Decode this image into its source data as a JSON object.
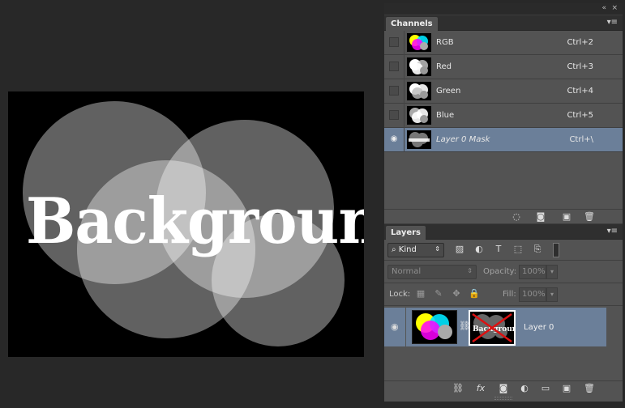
{
  "canvas": {
    "text": "Background"
  },
  "dock": {
    "collapse_icon": "double-chevron-icon",
    "close_icon": "close-icon"
  },
  "channels": {
    "tab_label": "Channels",
    "menu_icon": "panel-menu-icon",
    "rows": [
      {
        "name": "RGB",
        "shortcut": "Ctrl+2",
        "visible": false,
        "selected": false
      },
      {
        "name": "Red",
        "shortcut": "Ctrl+3",
        "visible": false,
        "selected": false
      },
      {
        "name": "Green",
        "shortcut": "Ctrl+4",
        "visible": false,
        "selected": false
      },
      {
        "name": "Blue",
        "shortcut": "Ctrl+5",
        "visible": false,
        "selected": false
      },
      {
        "name": "Layer 0 Mask",
        "shortcut": "Ctrl+\\",
        "visible": true,
        "selected": true
      }
    ],
    "footer_icons": [
      "load-selection-icon",
      "save-selection-icon",
      "new-channel-icon",
      "trash-icon"
    ]
  },
  "layers": {
    "tab_label": "Layers",
    "menu_icon": "panel-menu-icon",
    "kind_label": "Kind",
    "blend_mode": "Normal",
    "opacity_label": "Opacity:",
    "opacity_value": "100%",
    "lock_label": "Lock:",
    "fill_label": "Fill:",
    "fill_value": "100%",
    "layer": {
      "name": "Layer 0",
      "visible": true,
      "selected": true,
      "mask_thumb_text": "Background"
    },
    "footer_icons": [
      "link-icon",
      "fx-icon",
      "add-mask-icon",
      "adjustment-icon",
      "folder-icon",
      "new-layer-icon",
      "trash-icon"
    ],
    "fx_label": "fx"
  },
  "colors": {
    "selection": "#6b7f99",
    "panel": "#535353",
    "workspace": "#282828"
  }
}
